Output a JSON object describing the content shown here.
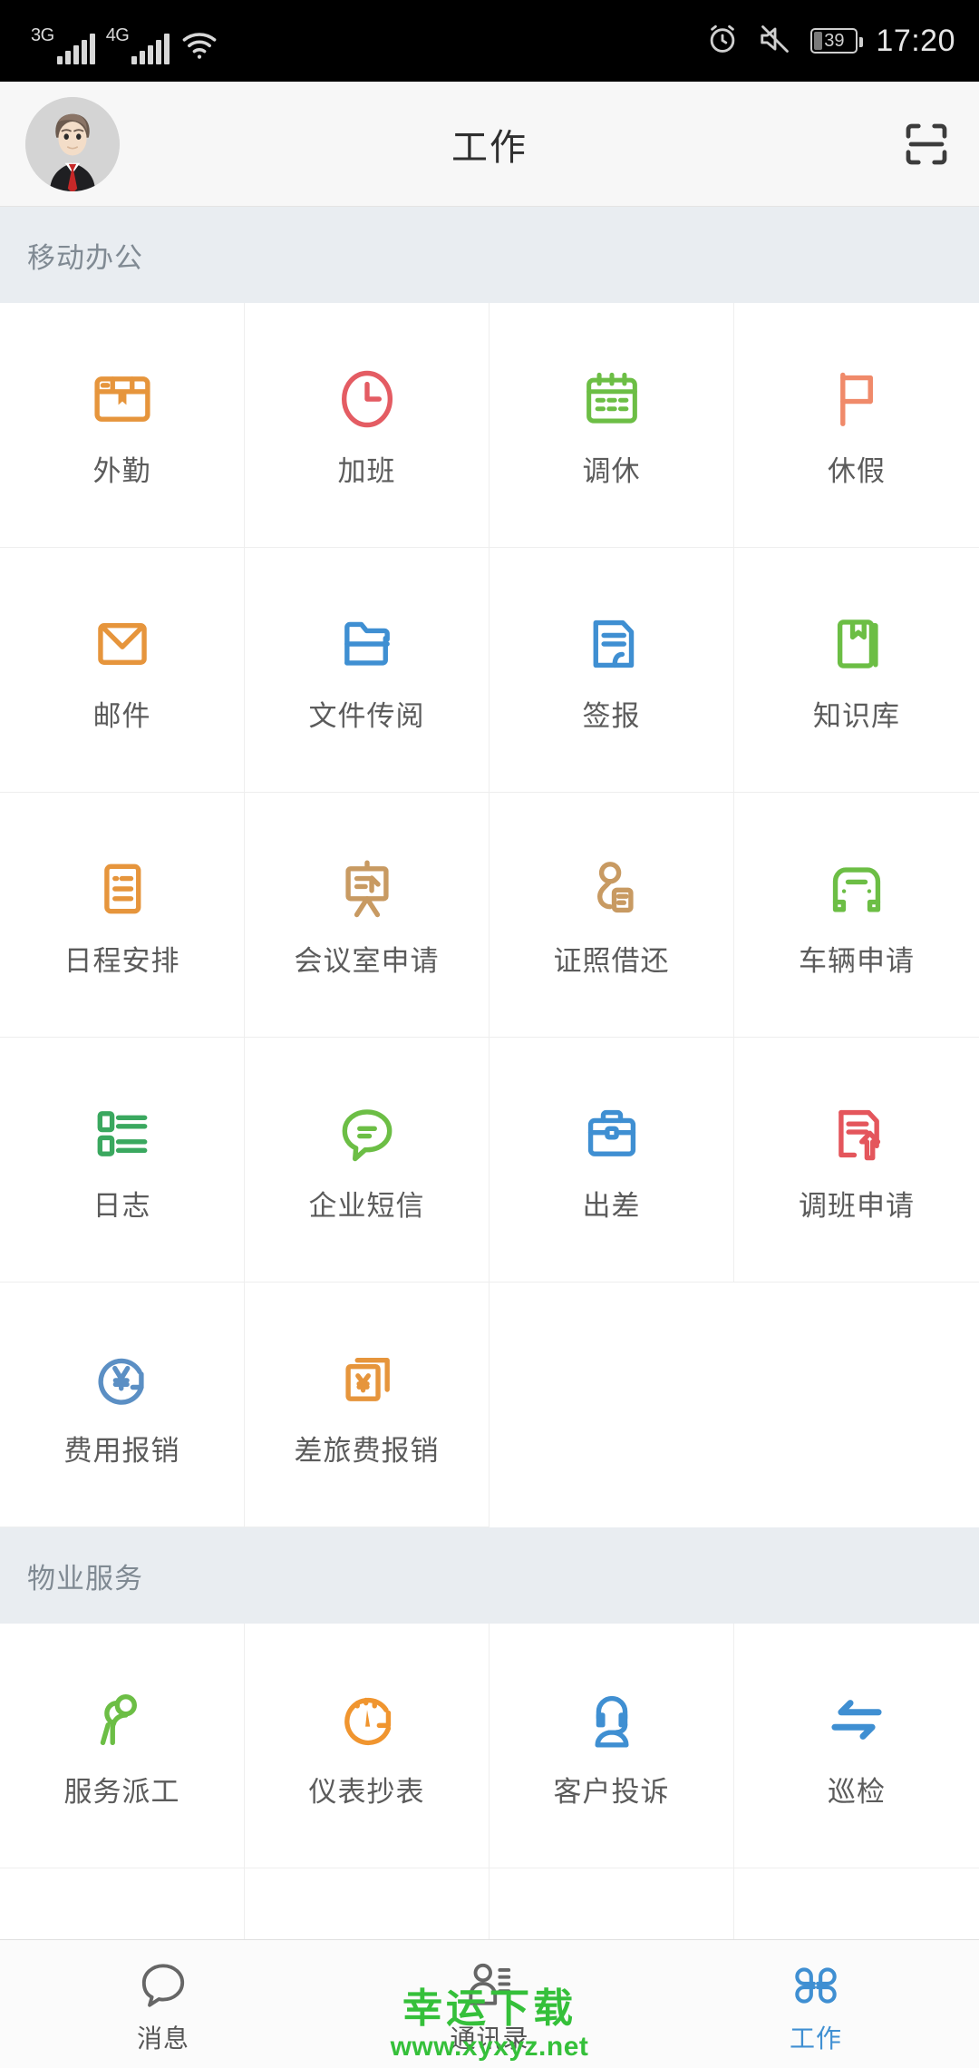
{
  "statusbar": {
    "net1_label": "3G",
    "net2_label": "4G",
    "wifi_icon": "wifi-icon",
    "alarm_icon": "alarm-icon",
    "mute_icon": "mute-icon",
    "battery_level": "39",
    "time": "17:20"
  },
  "header": {
    "title": "工作",
    "avatar_icon": "user-avatar",
    "scan_icon": "scan-icon"
  },
  "sections": [
    {
      "title": "移动办公",
      "items": [
        {
          "label": "外勤",
          "icon": "field-work-icon",
          "color": "#e6953c"
        },
        {
          "label": "加班",
          "icon": "clock-icon",
          "color": "#e45c63"
        },
        {
          "label": "调休",
          "icon": "calendar-icon",
          "color": "#6cbe45"
        },
        {
          "label": "休假",
          "icon": "flag-icon",
          "color": "#f08a6a"
        },
        {
          "label": "邮件",
          "icon": "envelope-icon",
          "color": "#e6953c"
        },
        {
          "label": "文件传阅",
          "icon": "folder-icon",
          "color": "#3f8fd2"
        },
        {
          "label": "签报",
          "icon": "document-sign-icon",
          "color": "#3f8fd2"
        },
        {
          "label": "知识库",
          "icon": "book-icon",
          "color": "#6cbe45"
        },
        {
          "label": "日程安排",
          "icon": "schedule-icon",
          "color": "#e6953c"
        },
        {
          "label": "会议室申请",
          "icon": "meeting-board-icon",
          "color": "#c89a62"
        },
        {
          "label": "证照借还",
          "icon": "badge-icon",
          "color": "#c89a62"
        },
        {
          "label": "车辆申请",
          "icon": "car-icon",
          "color": "#6cbe45"
        },
        {
          "label": "日志",
          "icon": "list-icon",
          "color": "#3aa85f"
        },
        {
          "label": "企业短信",
          "icon": "chat-bubble-icon",
          "color": "#6cbe45"
        },
        {
          "label": "出差",
          "icon": "briefcase-icon",
          "color": "#3f8fd2"
        },
        {
          "label": "调班申请",
          "icon": "shift-change-icon",
          "color": "#e4565c"
        },
        {
          "label": "费用报销",
          "icon": "yen-refund-icon",
          "color": "#5b8fc4"
        },
        {
          "label": "差旅费报销",
          "icon": "travel-expense-icon",
          "color": "#e6953c"
        }
      ]
    },
    {
      "title": "物业服务",
      "items": [
        {
          "label": "服务派工",
          "icon": "service-dispatch-icon",
          "color": "#6cbe45"
        },
        {
          "label": "仪表抄表",
          "icon": "meter-reading-icon",
          "color": "#f0952f"
        },
        {
          "label": "客户投诉",
          "icon": "customer-support-icon",
          "color": "#3f8fd2"
        },
        {
          "label": "巡检",
          "icon": "patrol-arrows-icon",
          "color": "#3f8fd2"
        }
      ],
      "partial_items": [
        {
          "label": "",
          "icon": "green-spiral-icon",
          "color": "#4faa44"
        },
        {
          "label": "",
          "icon": "tools-icon",
          "color": "#c89a62"
        },
        {
          "label": "",
          "icon": "folder-search-icon",
          "color": "#c89a62"
        },
        {
          "label": "",
          "icon": "sync-refresh-icon",
          "color": "#e4454e"
        }
      ]
    }
  ],
  "tabbar": {
    "items": [
      {
        "label": "消息",
        "icon": "message-icon",
        "active": false
      },
      {
        "label": "通讯录",
        "icon": "contacts-icon",
        "active": false
      },
      {
        "label": "工作",
        "icon": "work-grid-icon",
        "active": true
      }
    ],
    "active_color": "#3f8fd2"
  },
  "watermark": {
    "line1": "幸运下载",
    "line2": "www.xyxyz.net",
    "color": "#35c03a"
  }
}
